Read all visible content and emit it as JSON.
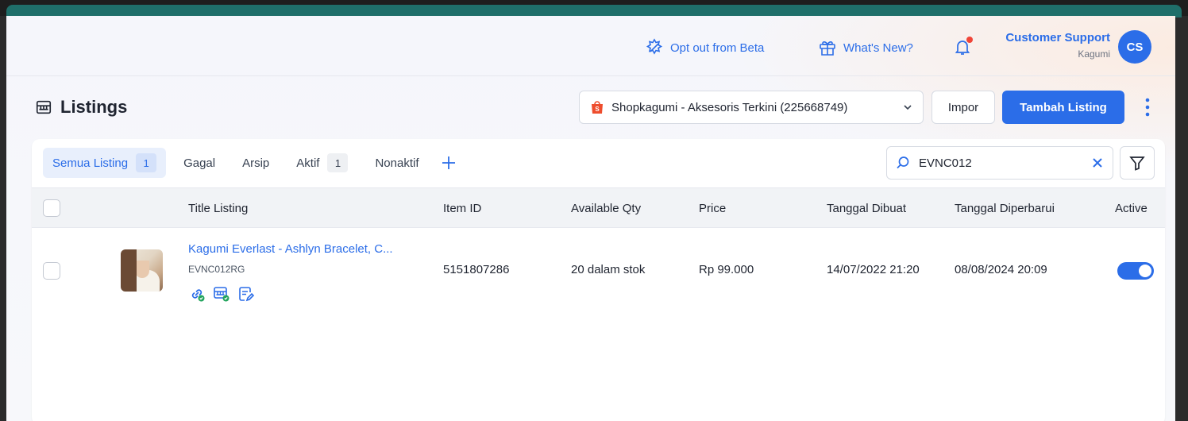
{
  "header": {
    "opt_out_label": "Opt out from Beta",
    "whats_new_label": "What's New?",
    "user_name": "Customer Support",
    "user_org": "Kagumi",
    "avatar_initials": "CS"
  },
  "page": {
    "title": "Listings",
    "shop_select_value": "Shopkagumi - Aksesoris Terkini (225668749)",
    "import_label": "Impor",
    "add_listing_label": "Tambah Listing"
  },
  "tabs": [
    {
      "label": "Semua Listing",
      "count": "1",
      "active": true
    },
    {
      "label": "Gagal"
    },
    {
      "label": "Arsip"
    },
    {
      "label": "Aktif",
      "count": "1"
    },
    {
      "label": "Nonaktif"
    }
  ],
  "search": {
    "value": "EVNC012"
  },
  "table": {
    "columns": {
      "title": "Title Listing",
      "item_id": "Item ID",
      "qty": "Available Qty",
      "price": "Price",
      "created": "Tanggal Dibuat",
      "updated": "Tanggal Diperbarui",
      "active": "Active"
    },
    "rows": [
      {
        "title": "Kagumi Everlast - Ashlyn Bracelet, C...",
        "sku": "EVNC012RG",
        "item_id": "5151807286",
        "qty": "20 dalam stok",
        "price": "Rp 99.000",
        "created": "14/07/2022 21:20",
        "updated": "08/08/2024 20:09",
        "active": true
      }
    ]
  },
  "colors": {
    "primary": "#2b6de8",
    "success": "#22a45d",
    "alert": "#f04438",
    "shop_brand": "#ee4d2d"
  },
  "icons": [
    "opt-out-icon",
    "gift-icon",
    "bell-icon",
    "listings-icon",
    "shop-bag-icon",
    "chevron-down-icon",
    "kebab-icon",
    "plus-icon",
    "search-icon",
    "clear-icon",
    "filter-icon",
    "link-icon",
    "store-icon",
    "edit-note-icon"
  ]
}
